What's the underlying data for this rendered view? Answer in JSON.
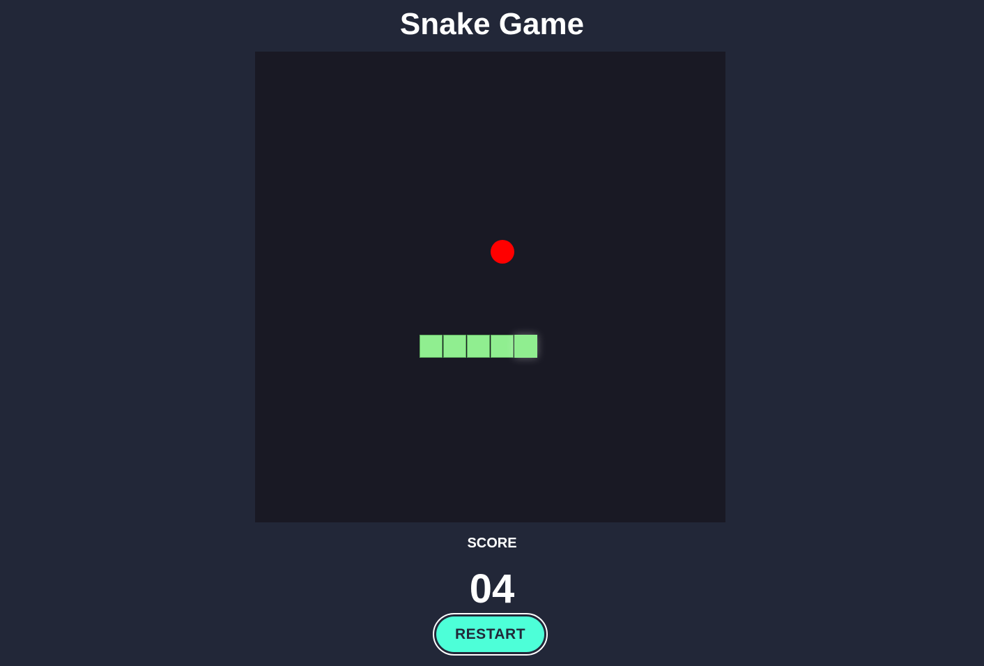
{
  "title": "Snake Game",
  "score": {
    "label": "SCORE",
    "value": "04"
  },
  "restart": {
    "label": "RESTART"
  },
  "game": {
    "snake_length": 5,
    "direction": "right",
    "food_color": "#ff0000",
    "snake_color": "#90ee90",
    "board_color": "#191924",
    "accent_color": "#4dffd8"
  }
}
